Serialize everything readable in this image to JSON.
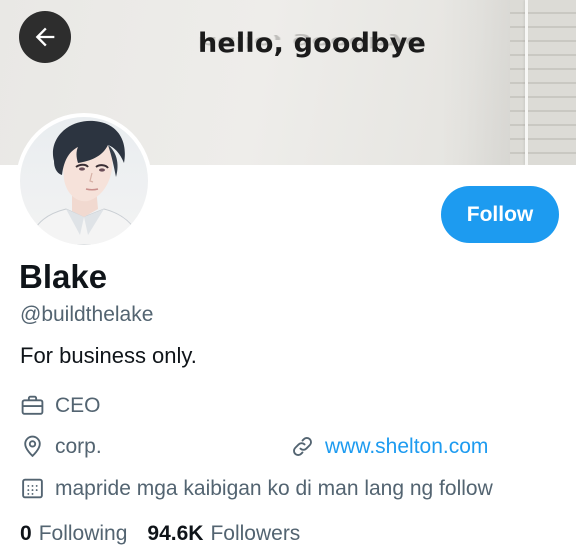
{
  "banner": {
    "text": "hello, goodbye"
  },
  "header": {
    "back_icon": "arrow-left-icon"
  },
  "profile": {
    "display_name": "Blake",
    "handle": "@buildthelake",
    "bio": "For business only.",
    "follow_label": "Follow",
    "profession": "CEO",
    "location": "corp.",
    "website": "www.shelton.com",
    "joined_text": "mapride mga kaibigan ko di man lang ng follow"
  },
  "stats": {
    "following_count": "0",
    "following_label": "Following",
    "followers_count": "94.6K",
    "followers_label": "Followers"
  },
  "icons": {
    "profession": "briefcase-icon",
    "location": "location-pin-icon",
    "website": "link-icon",
    "calendar": "calendar-icon"
  },
  "colors": {
    "accent": "#1d9bf0",
    "secondary_text": "#536471",
    "primary_text": "#0f1419"
  }
}
